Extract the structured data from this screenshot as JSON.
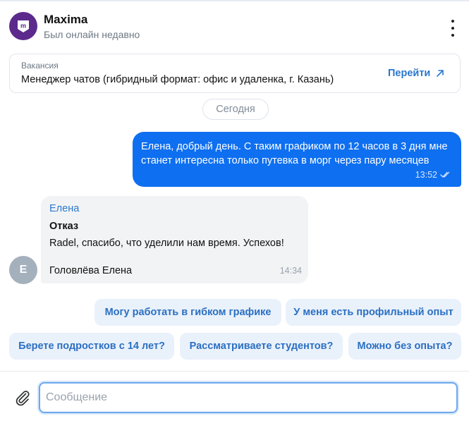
{
  "header": {
    "company_name": "Maxima",
    "status": "Был онлайн недавно",
    "logo_icon": "maxima-logo-icon",
    "menu_icon": "kebab-menu-icon",
    "brand_color": "#5b2a8c"
  },
  "vacancy": {
    "label": "Вакансия",
    "title": "Менеджер чатов (гибридный формат: офис и удаленка, г. Казань)",
    "link_label": "Перейти",
    "link_icon": "external-arrow-icon"
  },
  "date_separator": "Сегодня",
  "messages": [
    {
      "direction": "outgoing",
      "text": "Елена, добрый день. С таким графиком по 12 часов в 3 дня мне станет интересна только путевка в морг через пару месяцев",
      "time": "13:52",
      "status_icon": "double-check-icon",
      "color": "#0e6ff0"
    },
    {
      "direction": "incoming",
      "avatar_letter": "E",
      "sender": "Елена",
      "heading": "Отказ",
      "text": "Radel, спасибо, что уделили нам время. Успехов!",
      "signature": "Головлёва Елена",
      "time": "14:34"
    }
  ],
  "quick_replies": [
    "Могу работать в гибком графике",
    "У меня есть профильный опыт",
    "Берете подростков с 14 лет?",
    "Рассматриваете студентов?",
    "Можно без опыта?"
  ],
  "composer": {
    "placeholder": "Сообщение",
    "value": "",
    "attach_icon": "paperclip-icon"
  }
}
